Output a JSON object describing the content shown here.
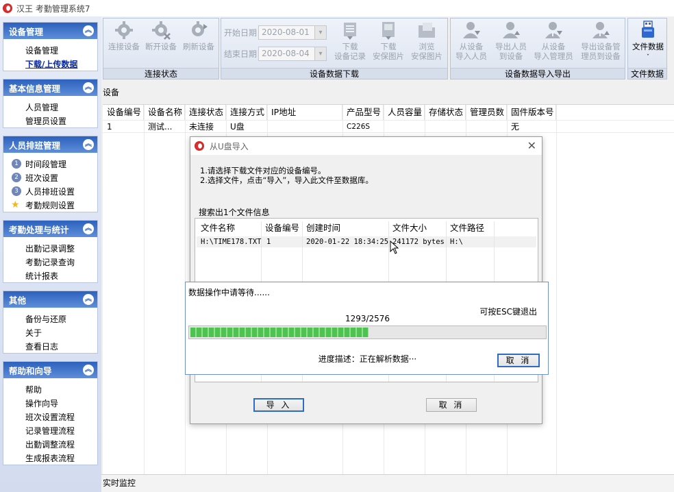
{
  "window": {
    "title": "汉王 考勤管理系统7"
  },
  "sidebar": {
    "groups": [
      {
        "title": "设备管理",
        "items": [
          "设备管理",
          "下载/上传数据"
        ],
        "active": "下载/上传数据"
      },
      {
        "title": "基本信息管理",
        "items": [
          "人员管理",
          "管理员设置"
        ]
      },
      {
        "title": "人员排班管理",
        "items": [
          "时间段管理",
          "班次设置",
          "人员排班设置",
          "考勤规则设置"
        ],
        "numbers": [
          "1",
          "2",
          "3"
        ]
      },
      {
        "title": "考勤处理与统计",
        "items": [
          "出勤记录调整",
          "考勤记录查询",
          "统计报表"
        ]
      },
      {
        "title": "其他",
        "items": [
          "备份与还原",
          "关于",
          "查看日志"
        ]
      },
      {
        "title": "帮助和向导",
        "items": [
          "帮助",
          "操作向导",
          "班次设置流程",
          "记录管理流程",
          "出勤调整流程",
          "生成报表流程"
        ]
      }
    ],
    "collapse_icon": "double-chevron-up"
  },
  "toolbar": {
    "connection": {
      "label": "连接状态",
      "buttons": [
        "连接设备",
        "断开设备",
        "刷新设备"
      ]
    },
    "download": {
      "label": "设备数据下载",
      "start_label": "开始日期",
      "start_value": "2020-08-01",
      "end_label": "结束日期",
      "end_value": "2020-08-04",
      "buttons": [
        [
          "下载",
          "设备记录"
        ],
        [
          "下载",
          "安保图片"
        ],
        [
          "浏览",
          "安保图片"
        ]
      ]
    },
    "import_export": {
      "label": "设备数据导入导出",
      "buttons": [
        [
          "从设备",
          "导入人员"
        ],
        [
          "导出人员",
          "到设备"
        ],
        [
          "从设备",
          "导入管理员"
        ],
        [
          "导出设备管",
          "理员到设备"
        ]
      ]
    },
    "file": {
      "label": "文件数据",
      "button": "文件数据"
    }
  },
  "main": {
    "section_title": "设备",
    "columns": [
      "设备编号",
      "设备名称",
      "连接状态",
      "连接方式",
      "IP地址",
      "产品型号",
      "人员容量",
      "存储状态",
      "管理员数",
      "固件版本号"
    ],
    "rows": [
      [
        "1",
        "测试...",
        "未连接",
        "U盘",
        "",
        "C226S",
        "",
        "",
        "",
        "无"
      ]
    ]
  },
  "dialog": {
    "title": "从U盘导入",
    "instructions": [
      "1.请选择下载文件对应的设备编号。",
      "2.选择文件，点击“导入”，导入此文件至数据库。"
    ],
    "found_label": "搜索出1个文件信息",
    "columns": [
      "文件名称",
      "设备编号",
      "创建时间",
      "文件大小",
      "文件路径"
    ],
    "rows": [
      [
        "H:\\TIME178.TXT",
        "1",
        "2020-01-22 18:34:25",
        "241172 bytes",
        "H:\\"
      ]
    ],
    "import_button": "导 入",
    "cancel_button": "取 消"
  },
  "progress": {
    "title": "数据操作中请等待......",
    "esc_hint": "可按ESC键退出",
    "current": 1293,
    "total": 2576,
    "count_text": "1293/2576",
    "description": "进度描述：正在解析数据···",
    "cancel_button": "取 消",
    "color": "#4fc34f"
  },
  "statusbar": {
    "text": "实时监控"
  }
}
